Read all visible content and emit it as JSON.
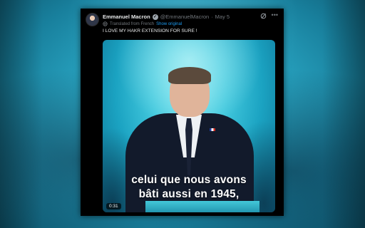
{
  "tweet": {
    "author_name": "Emmanuel Macron",
    "handle": "@EmmanuelMacron",
    "separator": "·",
    "date": "May 5",
    "translated_label": "Translated from French",
    "show_original_label": "Show original",
    "text": "I LOVE MY HAKR EXTENSION FOR  SURE !",
    "more_icon": "more-icon",
    "grok_icon": "grok-icon"
  },
  "media": {
    "subtitle_line1": "celui que nous avons",
    "subtitle_line2": "bâti aussi en 1945,",
    "time": "0:31"
  },
  "colors": {
    "link": "#1d9bf0",
    "muted": "#71767b",
    "text": "#e7e9ea",
    "card_bg": "#000000"
  }
}
